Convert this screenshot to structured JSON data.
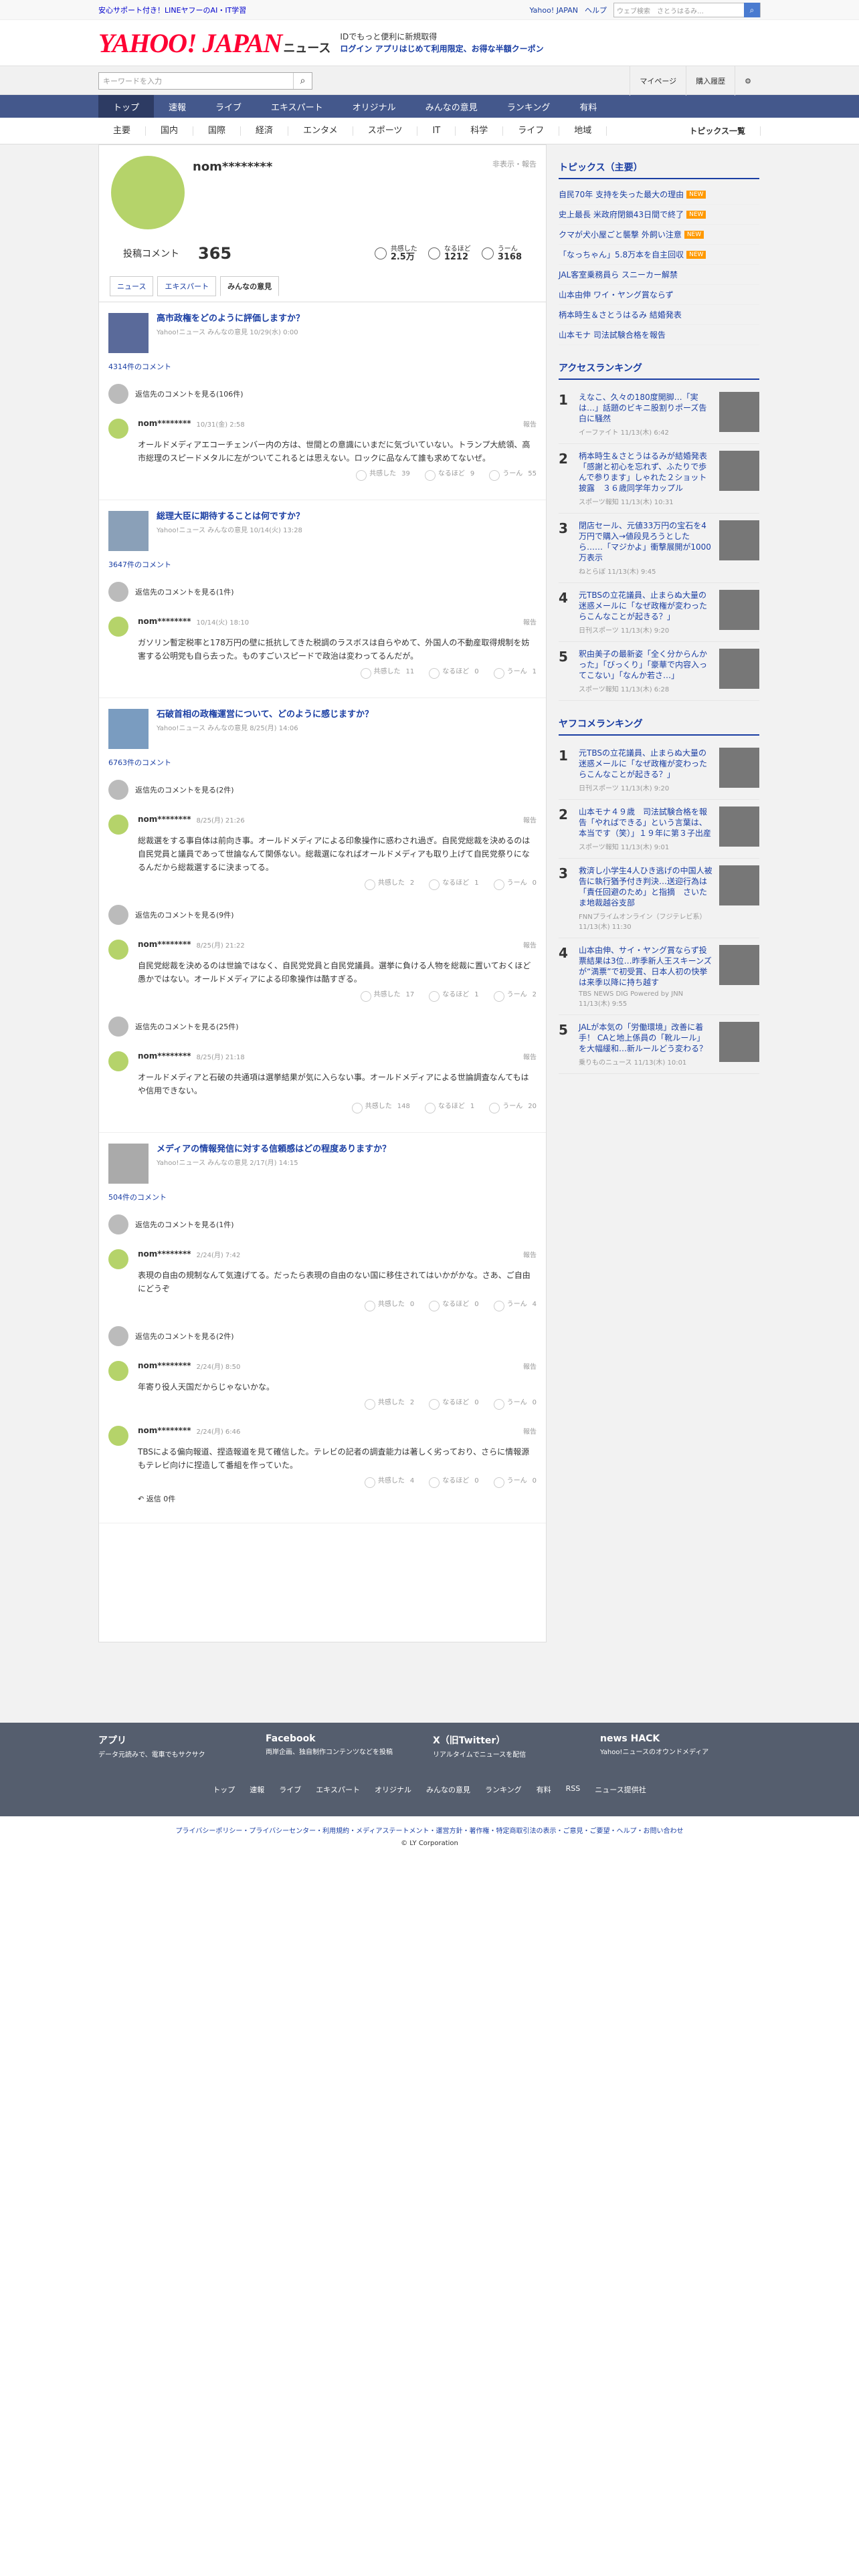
{
  "topbar": {
    "promo": "安心サポート付き！LINEヤフーのAI・IT学習",
    "links": [
      "Yahoo! JAPAN",
      "ヘルプ"
    ],
    "search_placeholder": "ウェブ検索　さとうはるみ…"
  },
  "header": {
    "logo": "YAHOO! JAPAN",
    "service": "ニュース",
    "promo_line1": "IDでもっと便利に新規取得",
    "promo_line2": "ログイン アプリはじめて利用限定、お得な半額クーポン"
  },
  "search": {
    "placeholder": "キーワードを入力",
    "mypage": "マイページ",
    "history": "購入履歴"
  },
  "gnav": [
    "トップ",
    "速報",
    "ライブ",
    "エキスパート",
    "オリジナル",
    "みんなの意見",
    "ランキング",
    "有料"
  ],
  "snav": [
    "主要",
    "国内",
    "国際",
    "経済",
    "エンタメ",
    "スポーツ",
    "IT",
    "科学",
    "ライフ",
    "地域"
  ],
  "snav_right": "トピックス一覧",
  "profile": {
    "name": "nom********",
    "report": "非表示・報告",
    "label": "投稿コメント",
    "count": "365",
    "r1_label": "共感した",
    "r1_val": "2.5万",
    "r2_label": "なるほど",
    "r2_val": "1212",
    "r3_label": "うーん",
    "r3_val": "3168"
  },
  "tabs": [
    "ニュース",
    "エキスパート",
    "みんなの意見"
  ],
  "articles": [
    {
      "title": "高市政権をどのように評価しますか？",
      "src": "Yahoo!ニュース みんなの意見 10/29(水) 0:00",
      "count": "4314件のコメント",
      "more1": "返信先のコメントを見る(106件)",
      "c1_name": "nom********",
      "c1_date": "10/31(金) 2:58",
      "c1_text": "オールドメディアエコーチェンバー内の方は、世間との意識にいまだに気づいていない。トランプ大統領、高市総理のスピードメタルに左がついてこれるとは思えない。ロックに品なんて誰も求めてないぜ。",
      "c1_r": [
        "39",
        "9",
        "55"
      ]
    },
    {
      "title": "総理大臣に期待することは何ですか？",
      "src": "Yahoo!ニュース みんなの意見 10/14(火) 13:28",
      "count": "3647件のコメント",
      "more1": "返信先のコメントを見る(1件)",
      "c1_name": "nom********",
      "c1_date": "10/14(火) 18:10",
      "c1_text": "ガソリン暫定税率と178万円の壁に抵抗してきた税調のラスボスは自らやめて、外国人の不動産取得規制を妨害する公明党も自ら去った。ものすごいスピードで政治は変わってるんだが。",
      "c1_r": [
        "11",
        "0",
        "1"
      ]
    },
    {
      "title": "石破首相の政権運営について、どのように感じますか？",
      "src": "Yahoo!ニュース みんなの意見 8/25(月) 14:06",
      "count": "6763件のコメント",
      "more1": "返信先のコメントを見る(2件)",
      "c1_name": "nom********",
      "c1_date": "8/25(月) 21:26",
      "c1_text": "総裁選をする事自体は前向き事。オールドメディアによる印象操作に惑わされ過ぎ。自民党総裁を決めるのは自民党員と議員であって世論なんて関係ない。総裁選になればオールドメディアも取り上げて自民党祭りになるんだから総裁選するに決まってる。",
      "c1_r": [
        "2",
        "1",
        "0"
      ],
      "more2": "返信先のコメントを見る(9件)",
      "c2_name": "nom********",
      "c2_date": "8/25(月) 21:22",
      "c2_text": "自民党総裁を決めるのは世論ではなく、自民党党員と自民党議員。選挙に負ける人物を総裁に置いておくほど愚かではない。オールドメディアによる印象操作は酷すぎる。",
      "c2_r": [
        "17",
        "1",
        "2"
      ],
      "more3": "返信先のコメントを見る(25件)",
      "c3_name": "nom********",
      "c3_date": "8/25(月) 21:18",
      "c3_text": "オールドメディアと石破の共通項は選挙結果が気に入らない事。オールドメディアによる世論調査なんてもはや信用できない。",
      "c3_r": [
        "148",
        "1",
        "20"
      ]
    },
    {
      "title": "メディアの情報発信に対する信頼感はどの程度ありますか？",
      "src": "Yahoo!ニュース みんなの意見 2/17(月) 14:15",
      "count": "504件のコメント",
      "more1": "返信先のコメントを見る(1件)",
      "c1_name": "nom********",
      "c1_date": "2/24(月) 7:42",
      "c1_text": "表現の自由の規制なんて気違げてる。だったら表現の自由のない国に移住されてはいかがかな。さあ、ご自由にどうぞ",
      "c1_r": [
        "0",
        "0",
        "4"
      ],
      "more2": "返信先のコメントを見る(2件)",
      "c2_name": "nom********",
      "c2_date": "2/24(月) 8:50",
      "c2_text": "年寄り役人天国だからじゃないかな。",
      "c2_r": [
        "2",
        "0",
        "0"
      ],
      "c3_name": "nom********",
      "c3_date": "2/24(月) 6:46",
      "c3_text": "TBSによる偏向報道、捏造報道を見て確信した。テレビの記者の調査能力は著しく劣っており、さらに情報源もテレビ向けに捏造して番組を作っていた。",
      "c3_r": [
        "4",
        "0",
        "0"
      ],
      "reply": "返信 0件"
    }
  ],
  "reactions": [
    "共感した",
    "なるほど",
    "うーん"
  ],
  "report": "報告",
  "side": {
    "topics_title": "トピックス（主要）",
    "topics": [
      "自民70年 支持を失った最大の理由",
      "史上最長 米政府閉鎖43日間で終了",
      "クマが犬小屋ごと襲撃 外飼い注意",
      "「なっちゃん」5.8万本を自主回収",
      "JAL客室乗務員ら スニーカー解禁",
      "山本由伸 ワイ・ヤング賞ならず",
      "柄本時生＆さとうはるみ 結婚発表",
      "山本モナ 司法試験合格を報告"
    ],
    "access_title": "アクセスランキング",
    "access": [
      {
        "no": "1",
        "t": "えなこ、久々の180度開脚…「実は…」話題のビキニ股割りポーズ告白に騒然",
        "s": "イーファイト 11/13(木) 6:42"
      },
      {
        "no": "2",
        "t": "柄本時生＆さとうはるみが結婚発表「感謝と初心を忘れず、ふたりで歩んで参ります」しゃれた２ショット披露　３６歳同学年カップル",
        "s": "スポーツ報知 11/13(木) 10:31"
      },
      {
        "no": "3",
        "t": "閉店セール、元値33万円の宝石を4万円で購入→値段見ろうとしたら……「マジかよ」衝撃展開が1000万表示",
        "s": "ねとらぼ 11/13(木) 9:45"
      },
      {
        "no": "4",
        "t": "元TBSの立花議員、止まらぬ大量の迷惑メールに「なぜ政権が変わったらこんなことが起きる？」",
        "s": "日刊スポーツ 11/13(木) 9:20"
      },
      {
        "no": "5",
        "t": "釈由美子の最新姿「全く分からんかった」「びっくり」「豪華で内容入ってこない」「なんか若さ…」",
        "s": "スポーツ報知 11/13(木) 6:28"
      }
    ],
    "yahoo_title": "ヤフコメランキング",
    "yahoo": [
      {
        "no": "1",
        "t": "元TBSの立花議員、止まらぬ大量の迷惑メールに「なぜ政権が変わったらこんなことが起きる？」",
        "s": "日刊スポーツ 11/13(木) 9:20"
      },
      {
        "no": "2",
        "t": "山本モナ４９歳　司法試験合格を報告「やればできる」という言葉は、本当です（笑）」１９年に第３子出産",
        "s": "スポーツ報知 11/13(木) 9:01"
      },
      {
        "no": "3",
        "t": "救済し小学生4人ひき逃げの中国人被告に執行猶予付き判決…送迎行為は「責任回避のため」と指摘　さいたま地裁越谷支部",
        "s": "FNNプライムオンライン（フジテレビ系） 11/13(木) 11:30"
      },
      {
        "no": "4",
        "t": "山本由伸、サイ・ヤング賞ならず投票結果は3位…昨季新人王スキーンズが“満票”で初受賞、日本人初の快挙は来季以降に持ち越す",
        "s": "TBS NEWS DIG Powered by JNN 11/13(木) 9:55"
      },
      {
        "no": "5",
        "t": "JALが本気の「労働環境」改善に着手！ CAと地上係員の「靴ルール」を大幅緩和…新ルールどう変わる？",
        "s": "乗りものニュース 11/13(木) 10:01"
      }
    ]
  },
  "footer": {
    "boxes": [
      {
        "t": "アプリ",
        "d": "データ元読みで、電車でもサクサク"
      },
      {
        "t": "Facebook",
        "d": "両岸企画、独自制作コンテンツなどを投稿"
      },
      {
        "t": "X（旧Twitter）",
        "d": "リアルタイムでニュースを配信"
      },
      {
        "t": "news HACK",
        "d": "Yahoo!ニュースのオウンドメディア"
      }
    ],
    "links": [
      "トップ",
      "速報",
      "ライブ",
      "エキスパート",
      "オリジナル",
      "みんなの意見",
      "ランキング",
      "有料",
      "RSS",
      "ニュース提供社"
    ],
    "bottom": "プライバシーポリシー・プライバシーセンター・利用規約・メディアステートメント・運営方針・著作権・特定商取引法の表示・ご意見・ご要望・ヘルプ・お問い合わせ",
    "copyright": "© LY Corporation"
  }
}
